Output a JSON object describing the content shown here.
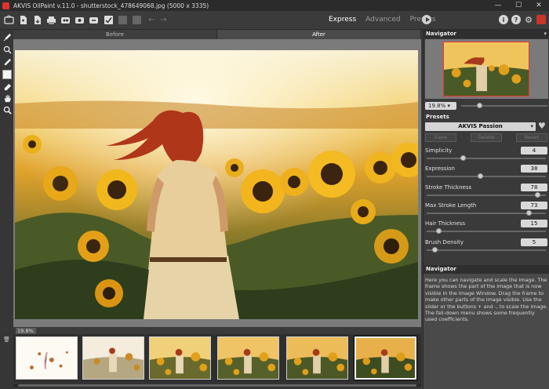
{
  "window": {
    "title": "AKVIS OilPaint v.11.0 - shutterstock_478649068.jpg (5000 x 3335)",
    "controls": [
      "—",
      "☐",
      "✕"
    ]
  },
  "toolbar": {
    "icons": [
      "home-icon",
      "open-icon",
      "save-icon",
      "print-icon",
      "batch-icon",
      "plugin-icon",
      "settings-icon",
      "apply-icon",
      "undo-icon",
      "redo-icon"
    ],
    "modes": [
      "Express",
      "Advanced",
      "Presets"
    ],
    "active_mode": "Express",
    "right_icons": [
      "info-icon",
      "help-icon",
      "gear-icon",
      "gift-icon"
    ],
    "info_glyph": "i",
    "help_glyph": "?",
    "gear_glyph": "⚙"
  },
  "tools": [
    "brush-icon",
    "history-brush-icon",
    "color-pick-icon",
    "swatch-icon",
    "eraser-icon",
    "hand-icon",
    "zoom-icon"
  ],
  "view_tabs": {
    "before": "Before",
    "after": "After"
  },
  "zoom_tag": "19.8%",
  "navigator": {
    "header": "Navigator",
    "zoom": "19.8%"
  },
  "presets": {
    "header": "Presets",
    "selected": "AKVIS Passion",
    "buttons": {
      "save": "Save",
      "delete": "Delete",
      "reset": "Reset"
    }
  },
  "params": [
    {
      "label": "Simplicity",
      "value": "4",
      "fraction": 0.29
    },
    {
      "label": "Expression",
      "value": "38",
      "fraction": 0.44
    },
    {
      "label": "Stroke Thickness",
      "value": "78",
      "fraction": 0.93
    },
    {
      "label": "Max Stroke Length",
      "value": "73",
      "fraction": 0.86
    },
    {
      "label": "Hair Thickness",
      "value": "15",
      "fraction": 0.08
    },
    {
      "label": "Brush Density",
      "value": "5",
      "fraction": 0.05
    }
  ],
  "help": {
    "header": "Navigator",
    "text": "Here you can navigate and scale the image. The frame shows the part of the image that is now visible in the Image Window. Drag the frame to make other parts of the image visible. Use the slider or the buttons + and -, to scale the image. The fall-down menu shows some frequently used coefficients."
  },
  "filmstrip": {
    "count": 6,
    "selected_index": 5
  },
  "colors": {
    "accent_red": "#c9352b",
    "panel_bg": "#3a3a3a",
    "header_bg": "#2f2f2f"
  }
}
